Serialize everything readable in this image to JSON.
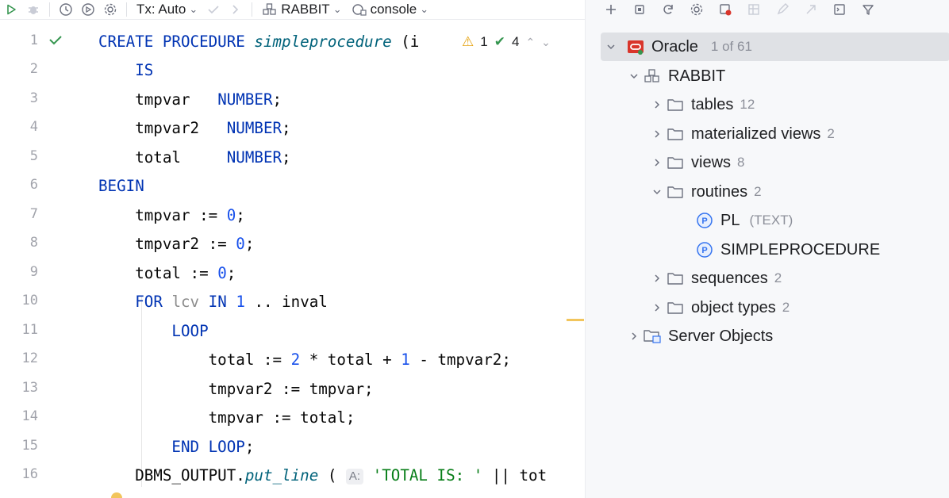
{
  "editor_toolbar": {
    "tx_mode": "Tx: Auto",
    "schema": "RABBIT",
    "console": "console"
  },
  "editor": {
    "line_numbers": [
      "1",
      "2",
      "3",
      "4",
      "5",
      "6",
      "7",
      "8",
      "9",
      "10",
      "11",
      "12",
      "13",
      "14",
      "15",
      "16"
    ],
    "inspection": {
      "warnings": "1",
      "ok_checks": "4"
    },
    "param_hint": "A:"
  },
  "explorer": {
    "root": {
      "label": "Oracle",
      "count": "1 of 61"
    },
    "schema": {
      "label": "RABBIT"
    },
    "folders": {
      "tables": {
        "label": "tables",
        "count": "12"
      },
      "materialized_views": {
        "label": "materialized views",
        "count": "2"
      },
      "views": {
        "label": "views",
        "count": "8"
      },
      "routines": {
        "label": "routines",
        "count": "2"
      },
      "sequences": {
        "label": "sequences",
        "count": "2"
      },
      "object_types": {
        "label": "object types",
        "count": "2"
      }
    },
    "routines": [
      {
        "label": "PL",
        "detail": "(TEXT)"
      },
      {
        "label": "SIMPLEPROCEDURE",
        "detail": ""
      }
    ],
    "server_objects": {
      "label": "Server Objects"
    }
  },
  "colors": {
    "keyword": "#0033b3",
    "number": "#1750eb",
    "string": "#067d17",
    "oracle_brand": "#d9352b",
    "selection": "#dfe1e5"
  },
  "icons": [
    "run-icon",
    "debug-icon",
    "history-icon",
    "explain-plan-icon",
    "settings-icon",
    "commit-icon",
    "rollback-icon",
    "schema-icon",
    "console-icon",
    "add-icon",
    "copy-icon",
    "refresh-icon",
    "gear-icon",
    "datasource-properties-icon",
    "filter-icon",
    "folder-icon",
    "procedure-icon",
    "chevron-right-icon",
    "chevron-down-icon"
  ]
}
